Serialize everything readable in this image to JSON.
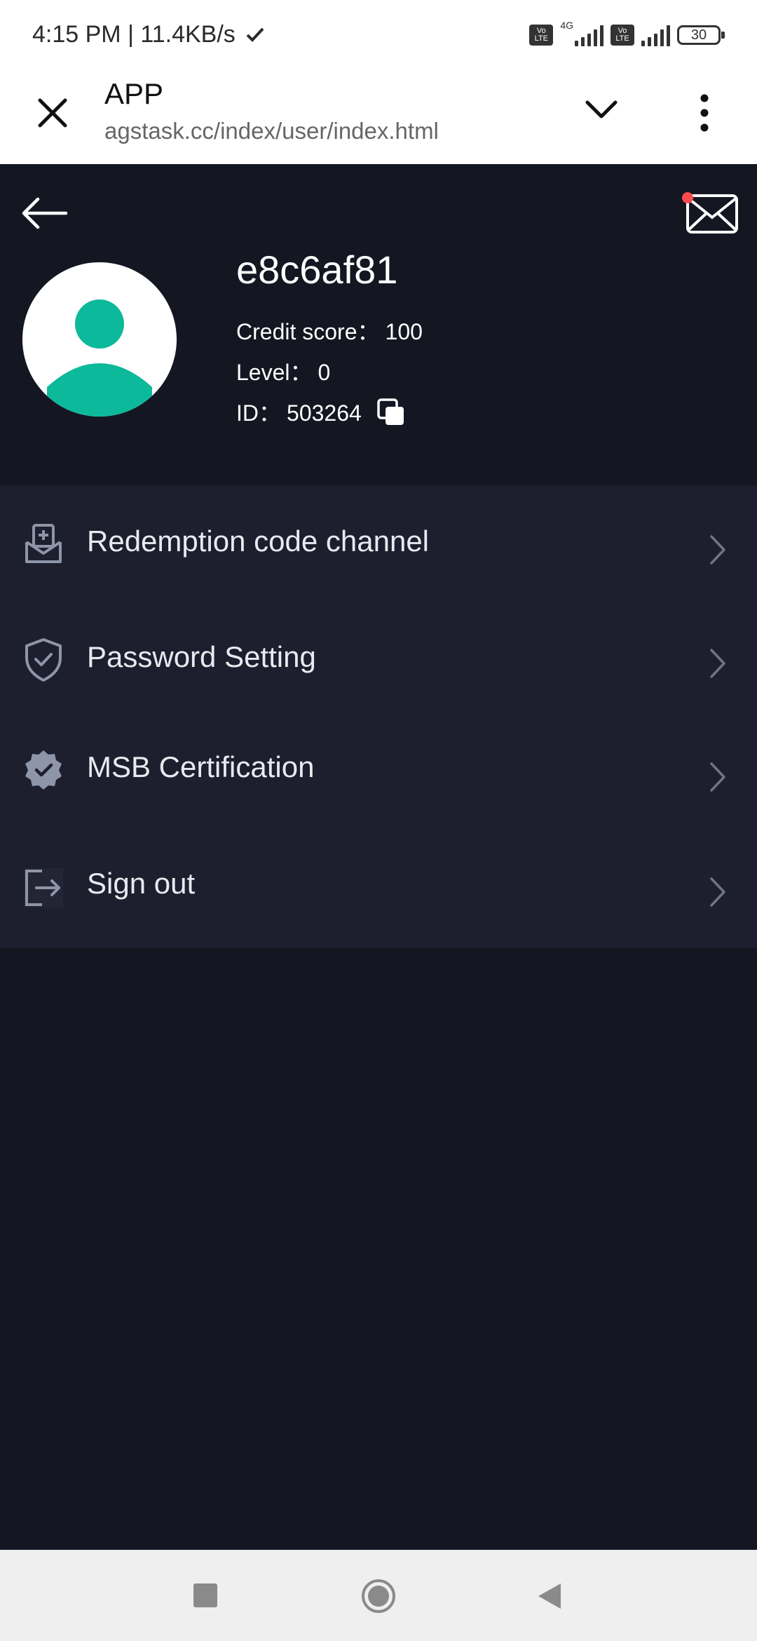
{
  "status_bar": {
    "time_speed": "4:15 PM | 11.4KB/s",
    "volte1": "Vo LTE",
    "network": "4G",
    "volte2": "Vo LTE",
    "battery": "30"
  },
  "browser": {
    "title": "APP",
    "url": "agstask.cc/index/user/index.html"
  },
  "profile": {
    "username": "e8c6af81",
    "credit_label": "Credit score：",
    "credit_value": "100",
    "level_label": "Level：",
    "level_value": "0",
    "id_label": "ID：",
    "id_value": "503264",
    "has_unread_mail": true
  },
  "menu": {
    "items": [
      {
        "label": "Redemption code channel",
        "icon": "redeem-box-icon"
      },
      {
        "label": "Password Setting",
        "icon": "shield-check-icon"
      },
      {
        "label": "MSB Certification",
        "icon": "verified-badge-icon"
      },
      {
        "label": "Sign out",
        "icon": "logout-icon"
      }
    ]
  },
  "colors": {
    "background": "#141622",
    "menu_background": "#1d1f2e",
    "avatar_accent": "#0cb99a",
    "unread_dot": "#ff4d4f"
  }
}
